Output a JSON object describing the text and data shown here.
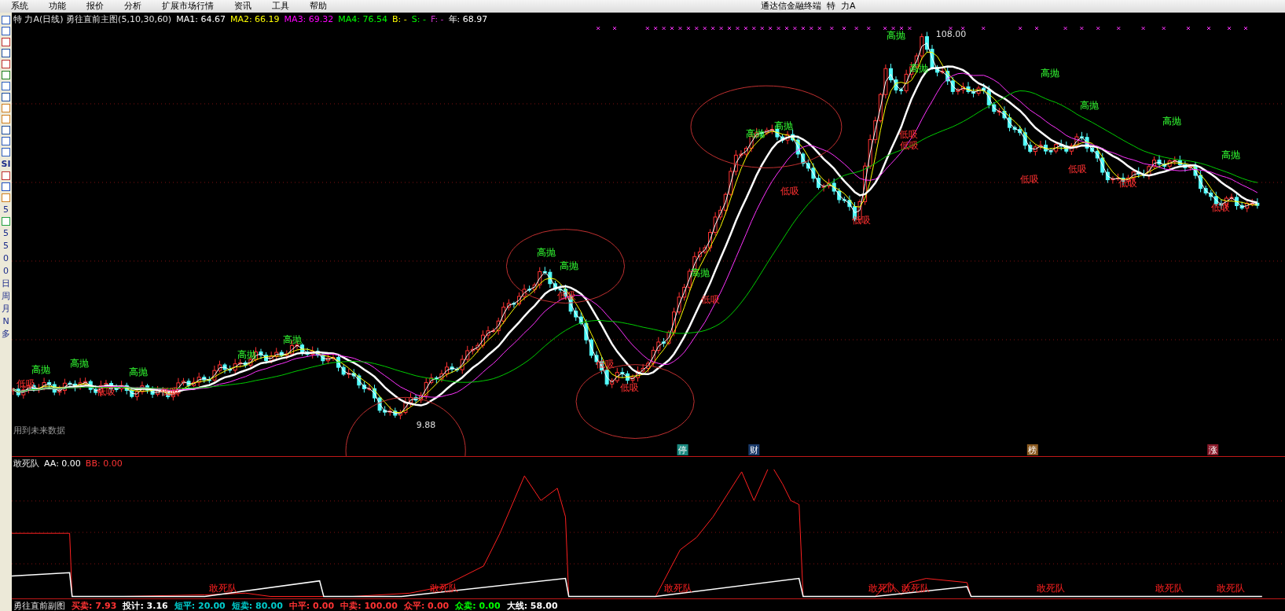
{
  "menu": [
    "系统",
    "功能",
    "报价",
    "分析",
    "扩展市场行情",
    "资讯",
    "工具",
    "帮助"
  ],
  "app_title": "通达信金融终端  特  力A",
  "toolbar": [
    {
      "kind": "icon"
    },
    {
      "kind": "icon"
    },
    {
      "kind": "icon"
    },
    {
      "kind": "icon"
    },
    {
      "kind": "icon"
    },
    {
      "kind": "icon"
    },
    {
      "kind": "icon"
    },
    {
      "kind": "icon"
    },
    {
      "kind": "icon"
    },
    {
      "kind": "icon"
    },
    {
      "kind": "icon"
    },
    {
      "kind": "icon"
    },
    {
      "kind": "icon"
    },
    {
      "kind": "text",
      "label": "SI"
    },
    {
      "kind": "icon"
    },
    {
      "kind": "icon"
    },
    {
      "kind": "icon"
    },
    {
      "kind": "text",
      "label": "5"
    },
    {
      "kind": "icon"
    },
    {
      "kind": "text",
      "label": "5"
    },
    {
      "kind": "text",
      "label": "5"
    },
    {
      "kind": "text",
      "label": "0"
    },
    {
      "kind": "text",
      "label": "0"
    },
    {
      "kind": "text",
      "label": "日"
    },
    {
      "kind": "text",
      "label": "周"
    },
    {
      "kind": "text",
      "label": "月"
    },
    {
      "kind": "text",
      "label": "N"
    },
    {
      "kind": "text",
      "label": "多"
    }
  ],
  "main_legend": {
    "title": "特  力A(日线) 勇往直前主图(5,10,30,60)",
    "items": [
      {
        "label": "MA1: 64.67",
        "color": "#ffffff"
      },
      {
        "label": "MA2: 66.19",
        "color": "#ffff00"
      },
      {
        "label": "MA3: 69.32",
        "color": "#ff00ff"
      },
      {
        "label": "MA4: 76.54",
        "color": "#00ff00"
      },
      {
        "label": "B: -",
        "color": "#ffff00"
      },
      {
        "label": "S: -",
        "color": "#00ff00"
      },
      {
        "label": "F: -",
        "color": "#cc33cc"
      },
      {
        "label": "年: 68.97",
        "color": "#ffffff"
      }
    ]
  },
  "price_labels": [
    {
      "text": "高抛",
      "kind": "sell"
    },
    {
      "text": "高抛",
      "kind": "sell"
    },
    {
      "text": "高抛",
      "kind": "sell"
    },
    {
      "text": "高抛",
      "kind": "sell"
    },
    {
      "text": "高抛",
      "kind": "sell"
    },
    {
      "text": "高抛",
      "kind": "sell"
    },
    {
      "text": "高抛",
      "kind": "sell"
    },
    {
      "text": "高抛",
      "kind": "sell"
    },
    {
      "text": "高抛",
      "kind": "sell"
    },
    {
      "text": "高抛",
      "kind": "sell"
    },
    {
      "text": "高抛",
      "kind": "sell"
    },
    {
      "text": "高抛",
      "kind": "sell"
    },
    {
      "text": "高抛",
      "kind": "sell"
    },
    {
      "text": "高抛",
      "kind": "sell"
    },
    {
      "text": "高抛",
      "kind": "sell"
    },
    {
      "text": "高抛",
      "kind": "sell"
    },
    {
      "text": "低吸",
      "kind": "buy"
    },
    {
      "text": "低吸",
      "kind": "buy"
    },
    {
      "text": "低吸",
      "kind": "buy"
    },
    {
      "text": "低吸",
      "kind": "buy"
    },
    {
      "text": "低吸",
      "kind": "buy"
    },
    {
      "text": "低吸",
      "kind": "buy"
    },
    {
      "text": "低吸",
      "kind": "buy"
    },
    {
      "text": "低吸",
      "kind": "buy"
    },
    {
      "text": "低吸",
      "kind": "buy"
    },
    {
      "text": "低吸",
      "kind": "buy"
    },
    {
      "text": "低吸",
      "kind": "buy"
    },
    {
      "text": "低吸",
      "kind": "buy"
    },
    {
      "text": "低吸",
      "kind": "buy"
    },
    {
      "text": "低吸",
      "kind": "buy"
    },
    {
      "text": "低吸",
      "kind": "buy"
    }
  ],
  "price_marks": [
    "108.00",
    "9.88"
  ],
  "future_data_note": "用到未来数据",
  "event_tags": [
    {
      "text": "停",
      "color": "#1a8a80"
    },
    {
      "text": "财",
      "color": "#1a3a6a"
    },
    {
      "text": "榜",
      "color": "#8a5a20"
    },
    {
      "text": "涨",
      "color": "#8a1a2a"
    }
  ],
  "sub_legend": {
    "title": "敢死队",
    "items": [
      {
        "label": "AA: 0.00",
        "color": "#ffffff"
      },
      {
        "label": "BB: 0.00",
        "color": "#ff3333"
      }
    ]
  },
  "sub_labels": [
    "敢死队",
    "敢死队",
    "敢死队",
    "敢死队",
    "敢死队",
    "敢死队",
    "敢死队",
    "敢死队"
  ],
  "status_line": {
    "title": "勇往直前副图",
    "items": [
      {
        "label": "买卖: 7.93",
        "color": "#ff3333"
      },
      {
        "label": "投计: 3.16",
        "color": "#ffffff"
      },
      {
        "label": "短平: 20.00",
        "color": "#00cccc"
      },
      {
        "label": "短卖: 80.00",
        "color": "#00cccc"
      },
      {
        "label": "中平: 0.00",
        "color": "#ff3333"
      },
      {
        "label": "中卖: 100.00",
        "color": "#ff3333"
      },
      {
        "label": "众平: 0.00",
        "color": "#ff3333"
      },
      {
        "label": "众卖: 0.00",
        "color": "#00ff00"
      },
      {
        "label": "大线: 58.00",
        "color": "#ffffff"
      }
    ]
  }
}
